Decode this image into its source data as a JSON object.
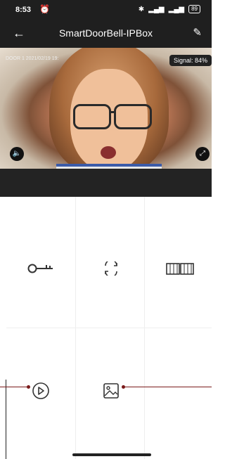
{
  "status_bar": {
    "time": "8:53",
    "alarm_icon": "alarm-clock-icon",
    "right_icons": [
      "bluetooth-icon",
      "signal-icon",
      "signal-icon"
    ],
    "battery": "89"
  },
  "header": {
    "title": "SmartDoorBell-IPBox",
    "back_icon": "arrow-left-icon",
    "edit_icon": "edit-icon"
  },
  "video": {
    "label": "DOOR 1 2021/02/19 19:",
    "signal": "Signal: 84%",
    "mute_icon": "speaker-mute-icon",
    "fullscreen_icon": "fullscreen-icon"
  },
  "controls": {
    "unlock_icon": "key-icon",
    "switch_icon": "refresh-icon",
    "gate_icon": "gate-icon",
    "playback_icon": "play-circle-icon",
    "gallery_icon": "image-icon"
  },
  "colors": {
    "bar": "#1f1f1f",
    "accent_annotation": "#7a1a1a"
  }
}
